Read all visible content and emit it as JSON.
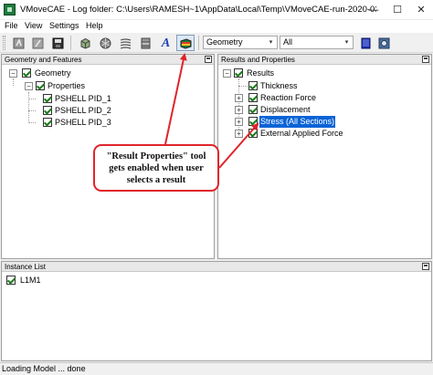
{
  "window": {
    "title": "VMoveCAE - Log folder: C:\\Users\\RAMESH~1\\AppData\\Local\\Temp\\VMoveCAE-run-2020-03-3...",
    "minimize_glyph": "—",
    "maximize_glyph": "☐",
    "close_glyph": "✕"
  },
  "menu": {
    "items": [
      "File",
      "View",
      "Settings",
      "Help"
    ]
  },
  "toolbar": {
    "mode_select": {
      "value": "Geometry"
    },
    "filter_select": {
      "value": "All"
    },
    "text_tool_glyph": "A",
    "dropdown_glyph": "▾"
  },
  "geometry_panel": {
    "title": "Geometry and Features",
    "tree": [
      {
        "label": "Geometry"
      },
      {
        "label": "Properties"
      },
      {
        "label": "PSHELL PID_1"
      },
      {
        "label": "PSHELL PID_2"
      },
      {
        "label": "PSHELL PID_3"
      }
    ]
  },
  "results_panel": {
    "title": "Results and Properties",
    "tree": [
      {
        "label": "Results"
      },
      {
        "label": "Thickness"
      },
      {
        "label": "Reaction Force"
      },
      {
        "label": "Displacement"
      },
      {
        "label": "Stress (All Sections)"
      },
      {
        "label": "External Applied Force"
      }
    ]
  },
  "instance_panel": {
    "title": "Instance List",
    "items": [
      {
        "label": "L1M1"
      }
    ]
  },
  "status": {
    "text": "Loading Model ... done"
  },
  "callout": {
    "line1": "\"Result Properties\" tool",
    "line2": "gets enabled when user",
    "line3": "selects a result"
  },
  "colors": {
    "selection": "#0a64d6",
    "annotation": "#e0242a",
    "check": "#1a7a1a"
  }
}
